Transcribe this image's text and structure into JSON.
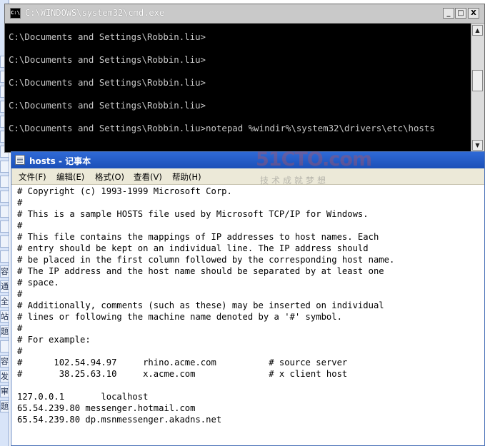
{
  "background_strip": {
    "chips": [
      "",
      "",
      "",
      "",
      "",
      "",
      "",
      "",
      "",
      "",
      "",
      "",
      "",
      "",
      "容",
      "通",
      "全",
      "站",
      "题",
      "",
      "容",
      "发",
      "审",
      "题"
    ]
  },
  "cmd": {
    "app_icon": "C:\\",
    "title": "C:\\WINDOWS\\system32\\cmd.exe",
    "buttons": {
      "minimize": "_",
      "maximize": "□",
      "close": "X"
    },
    "lines": [
      "C:\\Documents and Settings\\Robbin.liu>",
      "C:\\Documents and Settings\\Robbin.liu>",
      "C:\\Documents and Settings\\Robbin.liu>",
      "C:\\Documents and Settings\\Robbin.liu>",
      "C:\\Documents and Settings\\Robbin.liu>notepad %windir%\\system32\\drivers\\etc\\hosts"
    ],
    "scroll": {
      "up": "▲",
      "down": "▼"
    }
  },
  "notepad": {
    "title": "hosts - 记事本",
    "menu": [
      "文件(F)",
      "编辑(E)",
      "格式(O)",
      "查看(V)",
      "帮助(H)"
    ],
    "lines": [
      "# Copyright (c) 1993-1999 Microsoft Corp.",
      "#",
      "# This is a sample HOSTS file used by Microsoft TCP/IP for Windows.",
      "#",
      "# This file contains the mappings of IP addresses to host names. Each",
      "# entry should be kept on an individual line. The IP address should",
      "# be placed in the first column followed by the corresponding host name.",
      "# The IP address and the host name should be separated by at least one",
      "# space.",
      "#",
      "# Additionally, comments (such as these) may be inserted on individual",
      "# lines or following the machine name denoted by a '#' symbol.",
      "#",
      "# For example:",
      "#",
      "#      102.54.94.97     rhino.acme.com          # source server",
      "#       38.25.63.10     x.acme.com              # x client host",
      "",
      "127.0.0.1       localhost",
      "65.54.239.80 messenger.hotmail.com",
      "65.54.239.80 dp.msnmessenger.akadns.net"
    ]
  },
  "watermark": {
    "logo": "51CTO.com",
    "sub": "技术成就梦想"
  },
  "colors": {
    "cmd_bg": "#000000",
    "cmd_text": "#c8c8c8",
    "notepad_title": "#2563c8",
    "menu_bg": "#ece9d8"
  }
}
